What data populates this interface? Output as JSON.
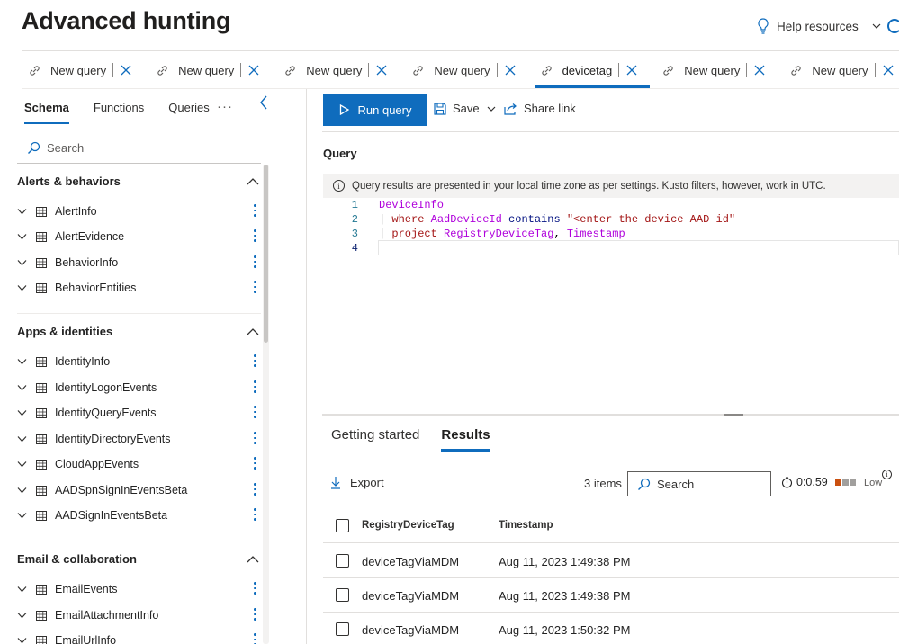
{
  "page": {
    "title": "Advanced hunting",
    "help_label": "Help resources"
  },
  "tabs": [
    {
      "label": "New query",
      "active": false
    },
    {
      "label": "New query",
      "active": false
    },
    {
      "label": "New query",
      "active": false
    },
    {
      "label": "New query",
      "active": false
    },
    {
      "label": "devicetag",
      "active": true
    },
    {
      "label": "New query",
      "active": false
    },
    {
      "label": "New query",
      "active": false
    }
  ],
  "sidebar": {
    "tabs": [
      "Schema",
      "Functions",
      "Queries"
    ],
    "active_tab": "Schema",
    "more_label": "···",
    "search_placeholder": "Search",
    "sections": [
      {
        "title": "Alerts & behaviors",
        "tables": [
          "AlertInfo",
          "AlertEvidence",
          "BehaviorInfo",
          "BehaviorEntities"
        ]
      },
      {
        "title": "Apps & identities",
        "tables": [
          "IdentityInfo",
          "IdentityLogonEvents",
          "IdentityQueryEvents",
          "IdentityDirectoryEvents",
          "CloudAppEvents",
          "AADSpnSignInEventsBeta",
          "AADSignInEventsBeta"
        ]
      },
      {
        "title": "Email & collaboration",
        "tables": [
          "EmailEvents",
          "EmailAttachmentInfo",
          "EmailUrlInfo"
        ]
      }
    ]
  },
  "toolbar": {
    "run_label": "Run query",
    "save_label": "Save",
    "share_label": "Share link"
  },
  "query": {
    "label": "Query",
    "info_text": "Query results are presented in your local time zone as per settings. Kusto filters, however, work in UTC.",
    "line_numbers": [
      "1",
      "2",
      "3",
      "4"
    ],
    "line1_table": "DeviceInfo",
    "line2_pipe": "| ",
    "line2_where": "where ",
    "line2_field": "AadDeviceId ",
    "line2_op": "contains ",
    "line2_string": "\"<enter the device AAD id\"",
    "line3_pipe": "| ",
    "line3_project": "project ",
    "line3_field1": "RegistryDeviceTag",
    "line3_comma": ", ",
    "line3_field2": "Timestamp"
  },
  "results": {
    "tabs": [
      "Getting started",
      "Results"
    ],
    "active_tab": "Results",
    "export_label": "Export",
    "items_count": "3 items",
    "search_placeholder": "Search",
    "duration": "0:0.59",
    "usage_level": "Low",
    "columns": [
      "RegistryDeviceTag",
      "Timestamp"
    ],
    "rows": [
      [
        "deviceTagViaMDM",
        "Aug 11, 2023 1:49:38 PM"
      ],
      [
        "deviceTagViaMDM",
        "Aug 11, 2023 1:49:38 PM"
      ],
      [
        "deviceTagViaMDM",
        "Aug 11, 2023 1:50:32 PM"
      ]
    ]
  },
  "colors": {
    "accent": "#0f6cbd",
    "usage_high": "#ca5010"
  }
}
